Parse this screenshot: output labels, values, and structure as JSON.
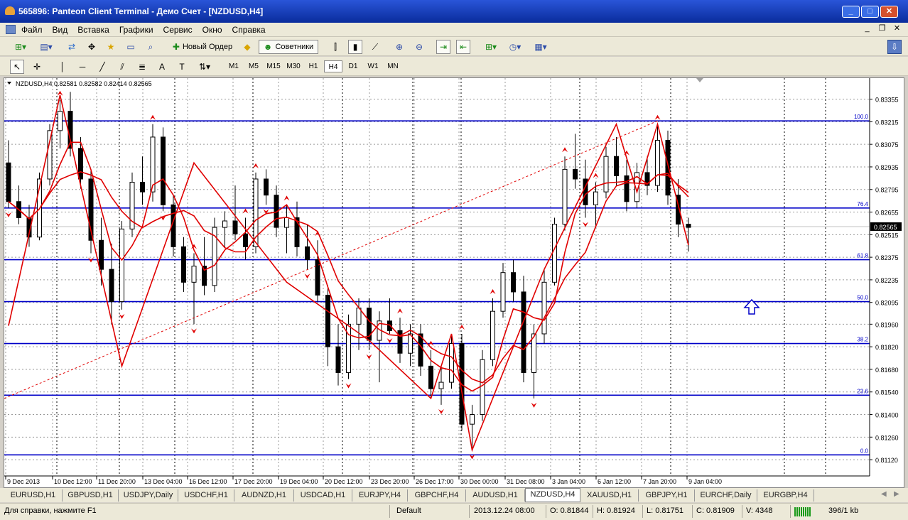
{
  "window": {
    "title": "565896: Panteon Client Terminal - Демо Счет - [NZDUSD,H4]"
  },
  "menu": [
    "Файл",
    "Вид",
    "Вставка",
    "Графики",
    "Сервис",
    "Окно",
    "Справка"
  ],
  "toolbar": {
    "new_order": "Новый Ордер",
    "advisors": "Советники"
  },
  "timeframes": [
    "M1",
    "M5",
    "M15",
    "M30",
    "H1",
    "H4",
    "D1",
    "W1",
    "MN"
  ],
  "active_timeframe": "H4",
  "chart_header": "NZDUSD,H4  0.82581 0.82582 0.82414 0.82565",
  "price_labels": [
    "0.83355",
    "0.83215",
    "0.83075",
    "0.82935",
    "0.82795",
    "0.82655",
    "0.82515",
    "0.82375",
    "0.82235",
    "0.82095",
    "0.81960",
    "0.81820",
    "0.81680",
    "0.81540",
    "0.81400",
    "0.81260",
    "0.81120"
  ],
  "current_price": "0.82565",
  "time_labels": [
    "9 Dec 2013",
    "10 Dec 12:00",
    "11 Dec 20:00",
    "13 Dec 04:00",
    "16 Dec 12:00",
    "17 Dec 20:00",
    "19 Dec 04:00",
    "20 Dec 12:00",
    "23 Dec 20:00",
    "26 Dec 17:00",
    "30 Dec 00:00",
    "31 Dec 08:00",
    "3 Jan 04:00",
    "6 Jan 12:00",
    "7 Jan 20:00",
    "9 Jan 04:00"
  ],
  "fib_labels": [
    "100.0",
    "76.4",
    "61.8",
    "50.0",
    "38.2",
    "23.6",
    "0.0"
  ],
  "tabs": [
    "EURUSD,H1",
    "GBPUSD,H1",
    "USDJPY,Daily",
    "USDCHF,H1",
    "AUDNZD,H1",
    "USDCAD,H1",
    "EURJPY,H4",
    "GBPCHF,H4",
    "AUDUSD,H1",
    "NZDUSD,H4",
    "XAUUSD,H1",
    "GBPJPY,H1",
    "EURCHF,Daily",
    "EURGBP,H4"
  ],
  "active_tab": "NZDUSD,H4",
  "status": {
    "help": "Для справки, нажмите F1",
    "profile": "Default",
    "datetime": "2013.12.24 08:00",
    "open": "O: 0.81844",
    "high": "H: 0.81924",
    "low": "L: 0.81751",
    "close": "C: 0.81909",
    "volume": "V: 4348",
    "traffic": "396/1 kb"
  },
  "colors": {
    "fib_line": "#0000c8",
    "trend": "#e00000",
    "candle": "#000000",
    "arrow_icon": "#0000c8"
  },
  "chart_data": {
    "type": "candlestick",
    "symbol": "NZDUSD",
    "timeframe": "H4",
    "ylim": [
      0.8105,
      0.8345
    ],
    "ohlc": [
      [
        0.8296,
        0.831,
        0.8268,
        0.8272
      ],
      [
        0.8272,
        0.8282,
        0.8258,
        0.8262
      ],
      [
        0.8262,
        0.827,
        0.8244,
        0.825
      ],
      [
        0.825,
        0.829,
        0.8248,
        0.8286
      ],
      [
        0.8286,
        0.832,
        0.8282,
        0.8316
      ],
      [
        0.8316,
        0.8335,
        0.8305,
        0.8328
      ],
      [
        0.8328,
        0.834,
        0.83,
        0.8305
      ],
      [
        0.8305,
        0.8312,
        0.828,
        0.8286
      ],
      [
        0.8286,
        0.8292,
        0.824,
        0.8248
      ],
      [
        0.8248,
        0.8262,
        0.822,
        0.823
      ],
      [
        0.823,
        0.8246,
        0.8196,
        0.821
      ],
      [
        0.821,
        0.826,
        0.8205,
        0.8255
      ],
      [
        0.8255,
        0.829,
        0.825,
        0.8284
      ],
      [
        0.8284,
        0.83,
        0.827,
        0.8278
      ],
      [
        0.8278,
        0.832,
        0.8272,
        0.8312
      ],
      [
        0.8312,
        0.8318,
        0.8266,
        0.827
      ],
      [
        0.827,
        0.8276,
        0.8238,
        0.8244
      ],
      [
        0.8244,
        0.825,
        0.8216,
        0.8222
      ],
      [
        0.8222,
        0.824,
        0.8196,
        0.8232
      ],
      [
        0.8232,
        0.825,
        0.8214,
        0.822
      ],
      [
        0.822,
        0.8262,
        0.8216,
        0.8256
      ],
      [
        0.8256,
        0.8266,
        0.8244,
        0.826
      ],
      [
        0.826,
        0.8282,
        0.8248,
        0.8252
      ],
      [
        0.8252,
        0.8262,
        0.8236,
        0.8244
      ],
      [
        0.8244,
        0.829,
        0.824,
        0.8286
      ],
      [
        0.8286,
        0.8292,
        0.827,
        0.8276
      ],
      [
        0.8276,
        0.8282,
        0.825,
        0.8256
      ],
      [
        0.8256,
        0.827,
        0.824,
        0.8262
      ],
      [
        0.8262,
        0.8272,
        0.8238,
        0.8244
      ],
      [
        0.8244,
        0.8258,
        0.823,
        0.8236
      ],
      [
        0.8236,
        0.8248,
        0.821,
        0.8214
      ],
      [
        0.8214,
        0.822,
        0.817,
        0.8182
      ],
      [
        0.8182,
        0.8196,
        0.8158,
        0.8166
      ],
      [
        0.8166,
        0.8202,
        0.8162,
        0.8196
      ],
      [
        0.8196,
        0.8212,
        0.818,
        0.8206
      ],
      [
        0.8206,
        0.8212,
        0.818,
        0.8186
      ],
      [
        0.8186,
        0.8204,
        0.816,
        0.8198
      ],
      [
        0.8198,
        0.8212,
        0.819,
        0.8192
      ],
      [
        0.8192,
        0.82,
        0.8172,
        0.8178
      ],
      [
        0.8178,
        0.8196,
        0.817,
        0.819
      ],
      [
        0.819,
        0.8196,
        0.8164,
        0.817
      ],
      [
        0.817,
        0.818,
        0.815,
        0.8156
      ],
      [
        0.8156,
        0.817,
        0.8146,
        0.816
      ],
      [
        0.816,
        0.819,
        0.8156,
        0.8184
      ],
      [
        0.8184,
        0.819,
        0.813,
        0.8134
      ],
      [
        0.8134,
        0.8146,
        0.8118,
        0.814
      ],
      [
        0.814,
        0.818,
        0.8136,
        0.8174
      ],
      [
        0.8174,
        0.8212,
        0.817,
        0.8204
      ],
      [
        0.8204,
        0.8234,
        0.82,
        0.8228
      ],
      [
        0.8228,
        0.8236,
        0.821,
        0.8216
      ],
      [
        0.8216,
        0.8226,
        0.816,
        0.8166
      ],
      [
        0.8166,
        0.8196,
        0.815,
        0.819
      ],
      [
        0.819,
        0.823,
        0.8184,
        0.8222
      ],
      [
        0.8222,
        0.8262,
        0.822,
        0.8258
      ],
      [
        0.8258,
        0.83,
        0.8254,
        0.8292
      ],
      [
        0.8292,
        0.8314,
        0.828,
        0.8286
      ],
      [
        0.8286,
        0.8298,
        0.8262,
        0.827
      ],
      [
        0.827,
        0.8284,
        0.8256,
        0.8278
      ],
      [
        0.8278,
        0.8306,
        0.8274,
        0.83
      ],
      [
        0.83,
        0.8312,
        0.8282,
        0.8288
      ],
      [
        0.8288,
        0.8298,
        0.8266,
        0.8272
      ],
      [
        0.8272,
        0.8296,
        0.8268,
        0.829
      ],
      [
        0.829,
        0.83,
        0.8276,
        0.8282
      ],
      [
        0.8282,
        0.832,
        0.8278,
        0.831
      ],
      [
        0.831,
        0.8316,
        0.827,
        0.8276
      ],
      [
        0.8276,
        0.8286,
        0.825,
        0.8258
      ],
      [
        0.8258,
        0.8262,
        0.8241,
        0.8256
      ]
    ]
  }
}
